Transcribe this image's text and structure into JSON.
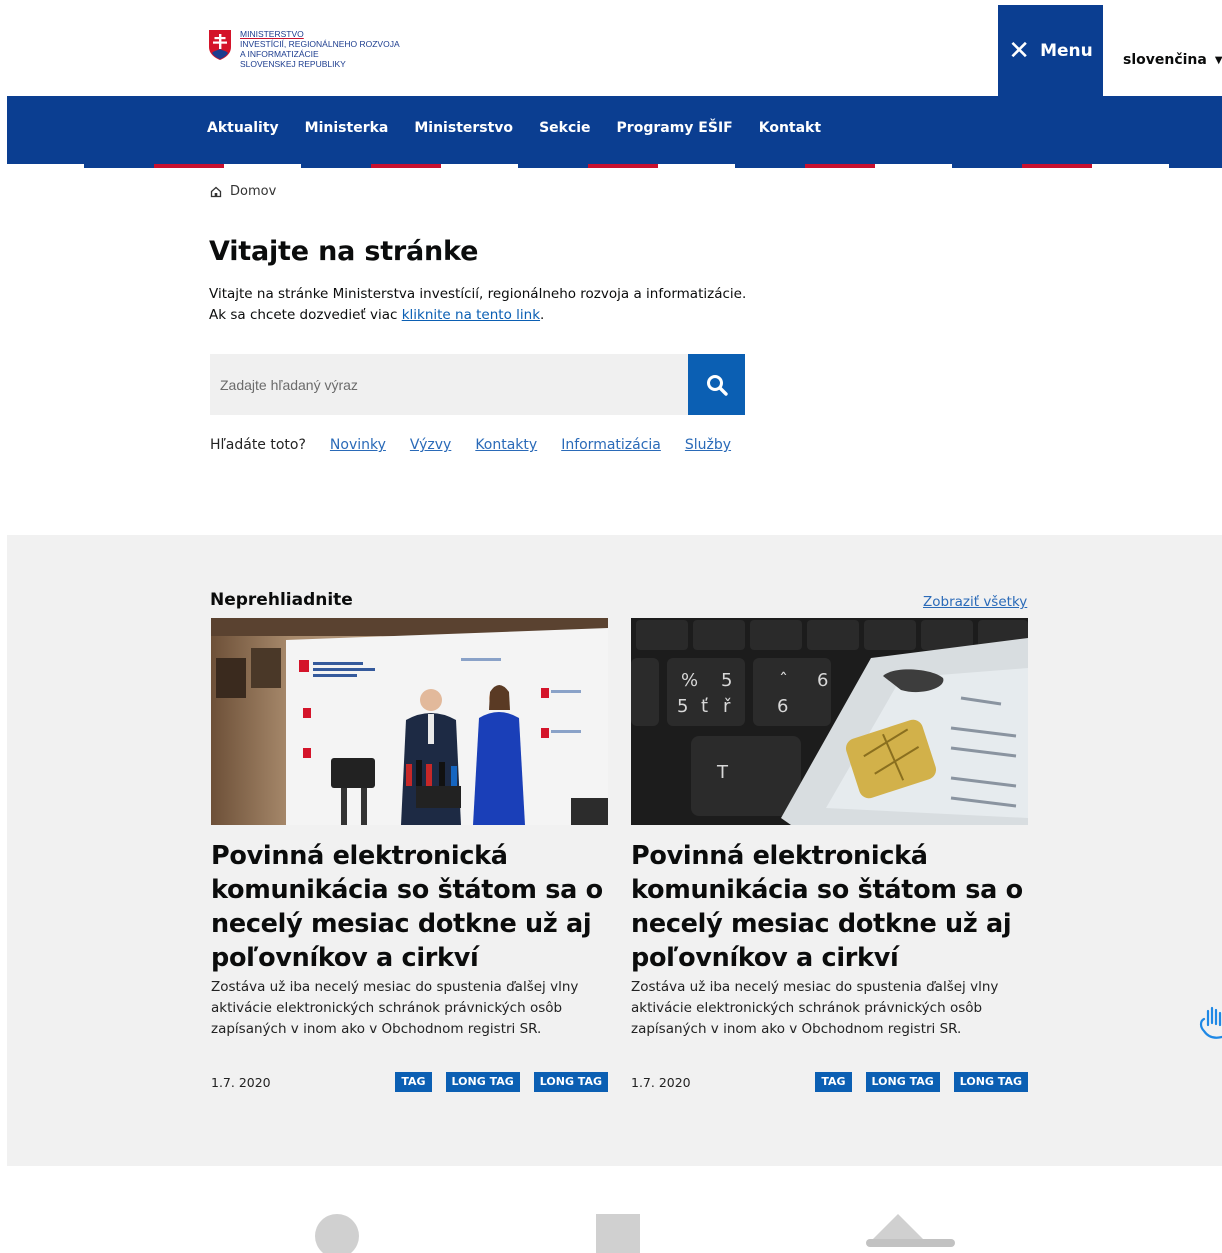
{
  "header": {
    "logo_lines": [
      "MINISTERSTVO",
      "INVESTÍCIÍ, REGIONÁLNEHO ROZVOJA",
      "A INFORMATIZÁCIE",
      "SLOVENSKEJ REPUBLIKY"
    ],
    "menu_label": "Menu",
    "language": "slovenčina"
  },
  "nav": {
    "items": [
      "Aktuality",
      "Ministerka",
      "Ministerstvo",
      "Sekcie",
      "Programy EŠIF",
      "Kontakt"
    ]
  },
  "breadcrumb": {
    "home": "Domov"
  },
  "hero": {
    "title": "Vitajte na stránke",
    "line1": "Vitajte na stránke Ministerstva investícií, regionálneho rozvoja a informatizácie.",
    "line2_prefix": "Ak sa chcete dozvedieť viac ",
    "line2_link": "kliknite na tento link",
    "line2_suffix": "."
  },
  "search": {
    "placeholder": "Zadajte hľadaný výraz",
    "suggest_label": "Hľadáte toto?",
    "suggest_links": [
      "Novinky",
      "Výzvy",
      "Kontakty",
      "Informatizácia",
      "Služby"
    ]
  },
  "featured": {
    "title": "Neprehliadnite",
    "see_all": "Zobraziť všetky",
    "cards": [
      {
        "title": "Povinná elektronická komunikácia so štátom sa o necelý mesiac dotkne už aj poľovníkov a cirkví",
        "text": "Zostáva už iba necelý mesiac do spustenia ďalšej vlny aktivácie elektronických schránok právnických osôb zapísaných v inom ako v Obchodnom registri SR.",
        "date": "1.7. 2020",
        "tags": [
          "TAG",
          "LONG TAG",
          "LONG TAG"
        ]
      },
      {
        "title": "Povinná elektronická komunikácia so štátom sa o necelý mesiac dotkne už aj poľovníkov a cirkví",
        "text": "Zostáva už iba necelý mesiac do spustenia ďalšej vlny aktivácie elektronických schránok právnických osôb zapísaných v inom ako v Obchodnom registri SR.",
        "date": "1.7. 2020",
        "tags": [
          "TAG",
          "LONG TAG",
          "LONG TAG"
        ]
      }
    ]
  },
  "colors": {
    "brand_blue": "#0b3e91",
    "link_blue": "#0b5fb3",
    "section_gray": "#f1f1f1",
    "flag_red": "#c8102e"
  },
  "icons": [
    "close-icon",
    "caret-down-icon",
    "home-icon",
    "search-icon",
    "hand-cursor-icon"
  ]
}
